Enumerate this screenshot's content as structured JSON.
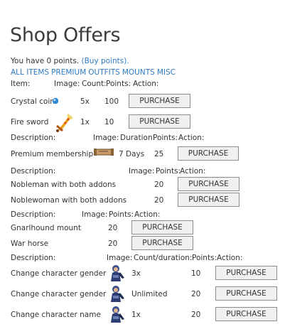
{
  "page": {
    "title": "Shop Offers"
  },
  "points": {
    "prefix": "You have 0 points.",
    "buy_link": "(Buy points)."
  },
  "nav": [
    "ALL ITEMS",
    "PREMIUM",
    "OUTFITS",
    "MOUNTS",
    "MISC"
  ],
  "items": {
    "headers": [
      "Item:",
      "Image:",
      "Count:",
      "Points:",
      "Action:"
    ],
    "rows": [
      {
        "name": "Crystal coin",
        "icon": "crystal-coin-icon",
        "count": "5x",
        "points": "100",
        "action": "PURCHASE"
      },
      {
        "name": "Fire sword",
        "icon": "fire-sword-icon",
        "count": "1x",
        "points": "10",
        "action": "PURCHASE"
      }
    ]
  },
  "premium": {
    "headers": [
      "Description:",
      "Image:",
      "Duration:",
      "Points:",
      "Action:"
    ],
    "rows": [
      {
        "name": "Premium membership",
        "icon": "premium-scroll-icon",
        "duration": "7 Days",
        "points": "25",
        "action": "PURCHASE"
      }
    ]
  },
  "outfits": {
    "headers": [
      "Description:",
      "Image:",
      "Points:",
      "Action:"
    ],
    "rows": [
      {
        "name": "Nobleman with both addons",
        "points": "20",
        "action": "PURCHASE"
      },
      {
        "name": "Noblewoman with both addons",
        "points": "20",
        "action": "PURCHASE"
      }
    ]
  },
  "mounts": {
    "headers": [
      "Description:",
      "Image:",
      "Points:",
      "Action:"
    ],
    "rows": [
      {
        "name": "Gnarlhound mount",
        "points": "20",
        "action": "PURCHASE"
      },
      {
        "name": "War horse",
        "points": "20",
        "action": "PURCHASE"
      }
    ]
  },
  "misc": {
    "headers": [
      "Description:",
      "Image:",
      "Count/duration:",
      "Points:",
      "Action:"
    ],
    "rows": [
      {
        "name": "Change character gender",
        "icon": "character-icon",
        "count": "3x",
        "points": "10",
        "action": "PURCHASE"
      },
      {
        "name": "Change character gender",
        "icon": "character-icon",
        "count": "Unlimited",
        "points": "20",
        "action": "PURCHASE"
      },
      {
        "name": "Change character name",
        "icon": "character-icon",
        "count": "1x",
        "points": "20",
        "action": "PURCHASE"
      }
    ]
  }
}
